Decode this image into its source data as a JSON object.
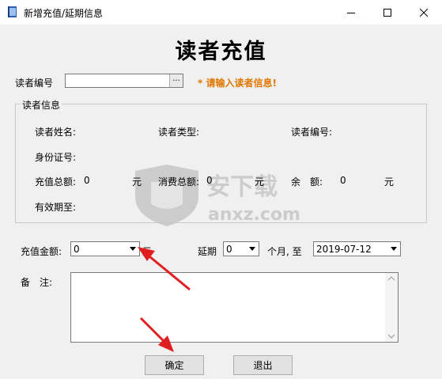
{
  "window": {
    "title": "新增充值/延期信息"
  },
  "heading": "读者充值",
  "reader_no": {
    "label": "读者编号",
    "value": "",
    "browse_label": "...",
    "hint": "* 请输入读者信息!"
  },
  "reader_info": {
    "legend": "读者信息",
    "name_label": "读者姓名:",
    "type_label": "读者类型:",
    "no_label": "读者编号:",
    "id_card_label": "身份证号:",
    "recharge_total_label": "充值总额:",
    "recharge_total_value": "0",
    "consume_total_label": "消费总额:",
    "consume_total_value": "0",
    "balance_label": "余　额:",
    "balance_value": "0",
    "unit": "元",
    "expiry_label": "有效期至:"
  },
  "amount": {
    "label": "充值金额:",
    "value": "0",
    "unit": "元"
  },
  "extend": {
    "label": "延期",
    "months_value": "0",
    "months_unit": "个月, 至",
    "date_value": "2019-07-12"
  },
  "remark": {
    "label": "备　注:",
    "value": ""
  },
  "buttons": {
    "ok": "确定",
    "exit": "退出"
  },
  "watermark": {
    "text_cn": "安下载",
    "text_en": "anxz.com"
  },
  "colors": {
    "hint": "#e07800",
    "arrow": "#e02020"
  }
}
